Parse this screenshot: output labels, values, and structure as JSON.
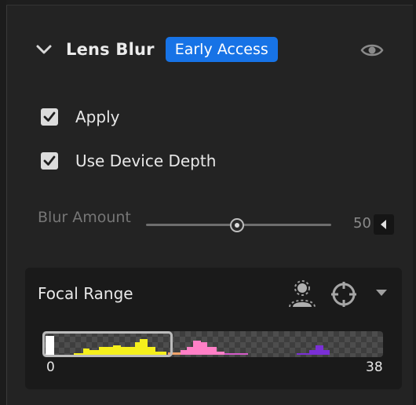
{
  "panel": {
    "title": "Lens Blur",
    "badge": "Early Access",
    "badge_color": "#1773e6",
    "icons": {
      "collapse": "chevron-down-icon",
      "visibility": "eye-icon"
    }
  },
  "options": [
    {
      "label": "Apply",
      "checked": true
    },
    {
      "label": "Use Device Depth",
      "checked": true
    }
  ],
  "blur_amount": {
    "label": "Blur Amount",
    "value": "50",
    "fraction": 0.5,
    "step_icon": "caret-left-icon"
  },
  "focal_range": {
    "title": "Focal Range",
    "icons": {
      "subject": "person-select-icon",
      "target": "crosshair-icon",
      "menu": "triangle-down-icon"
    },
    "min": "0",
    "max": "38",
    "selection_fraction": [
      0.0,
      0.38
    ]
  }
}
